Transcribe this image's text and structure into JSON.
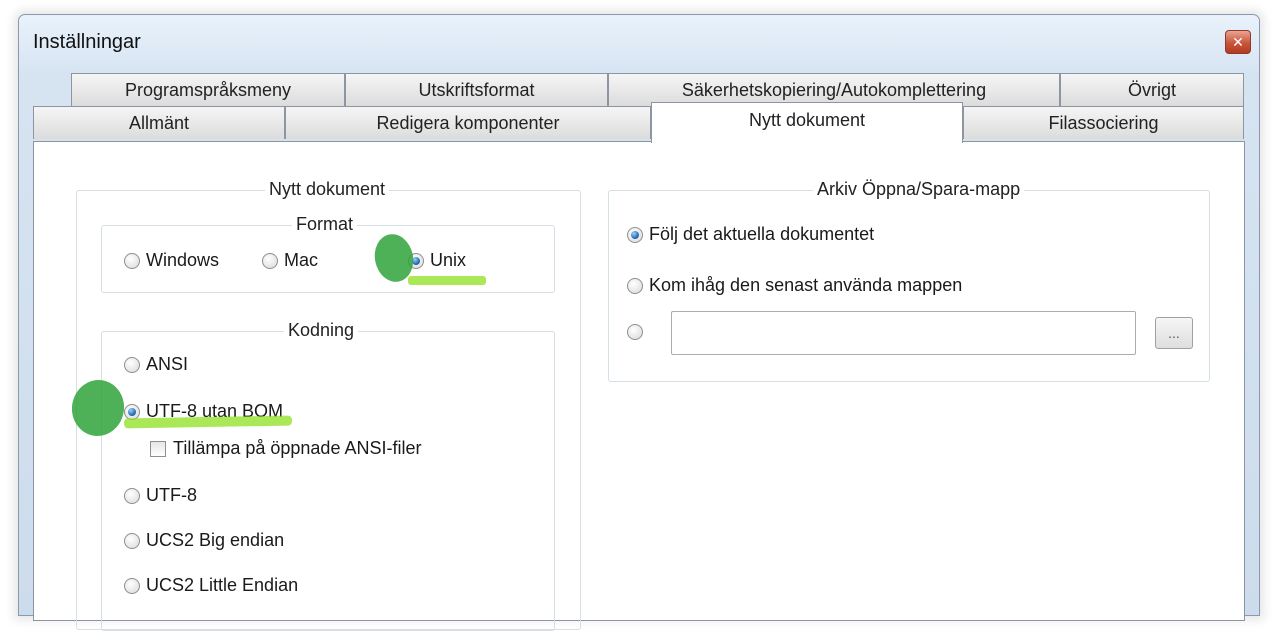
{
  "window": {
    "title": "Inställningar",
    "close_symbol": "✕"
  },
  "tabs": {
    "row1": [
      "Programspråksmeny",
      "Utskriftsformat",
      "Säkerhetskopiering/Autokomplettering",
      "Övrigt"
    ],
    "row2": [
      "Allmänt",
      "Redigera komponenter",
      "Nytt dokument",
      "Filassociering"
    ],
    "active": "Nytt dokument"
  },
  "new_document": {
    "group_title": "Nytt dokument",
    "format": {
      "title": "Format",
      "options": [
        "Windows",
        "Mac",
        "Unix"
      ],
      "selected": "Unix"
    },
    "encoding": {
      "title": "Kodning",
      "options": [
        "ANSI",
        "UTF-8 utan BOM",
        "UTF-8",
        "UCS2 Big endian",
        "UCS2 Little Endian"
      ],
      "selected": "UTF-8 utan BOM",
      "apply_checkbox_label": "Tillämpa på öppnade ANSI-filer",
      "apply_checked": false
    }
  },
  "open_save_folder": {
    "title": "Arkiv Öppna/Spara-mapp",
    "options": [
      "Följ det aktuella dokumentet",
      "Kom ihåg den senast använda mappen"
    ],
    "selected": "Följ det aktuella dokumentet",
    "custom_path_value": "",
    "browse_label": "..."
  },
  "colors": {
    "highlight_mark": "#8ee01f",
    "blob_mark": "#2fa33a",
    "accent_radio": "#1b5fa8"
  }
}
